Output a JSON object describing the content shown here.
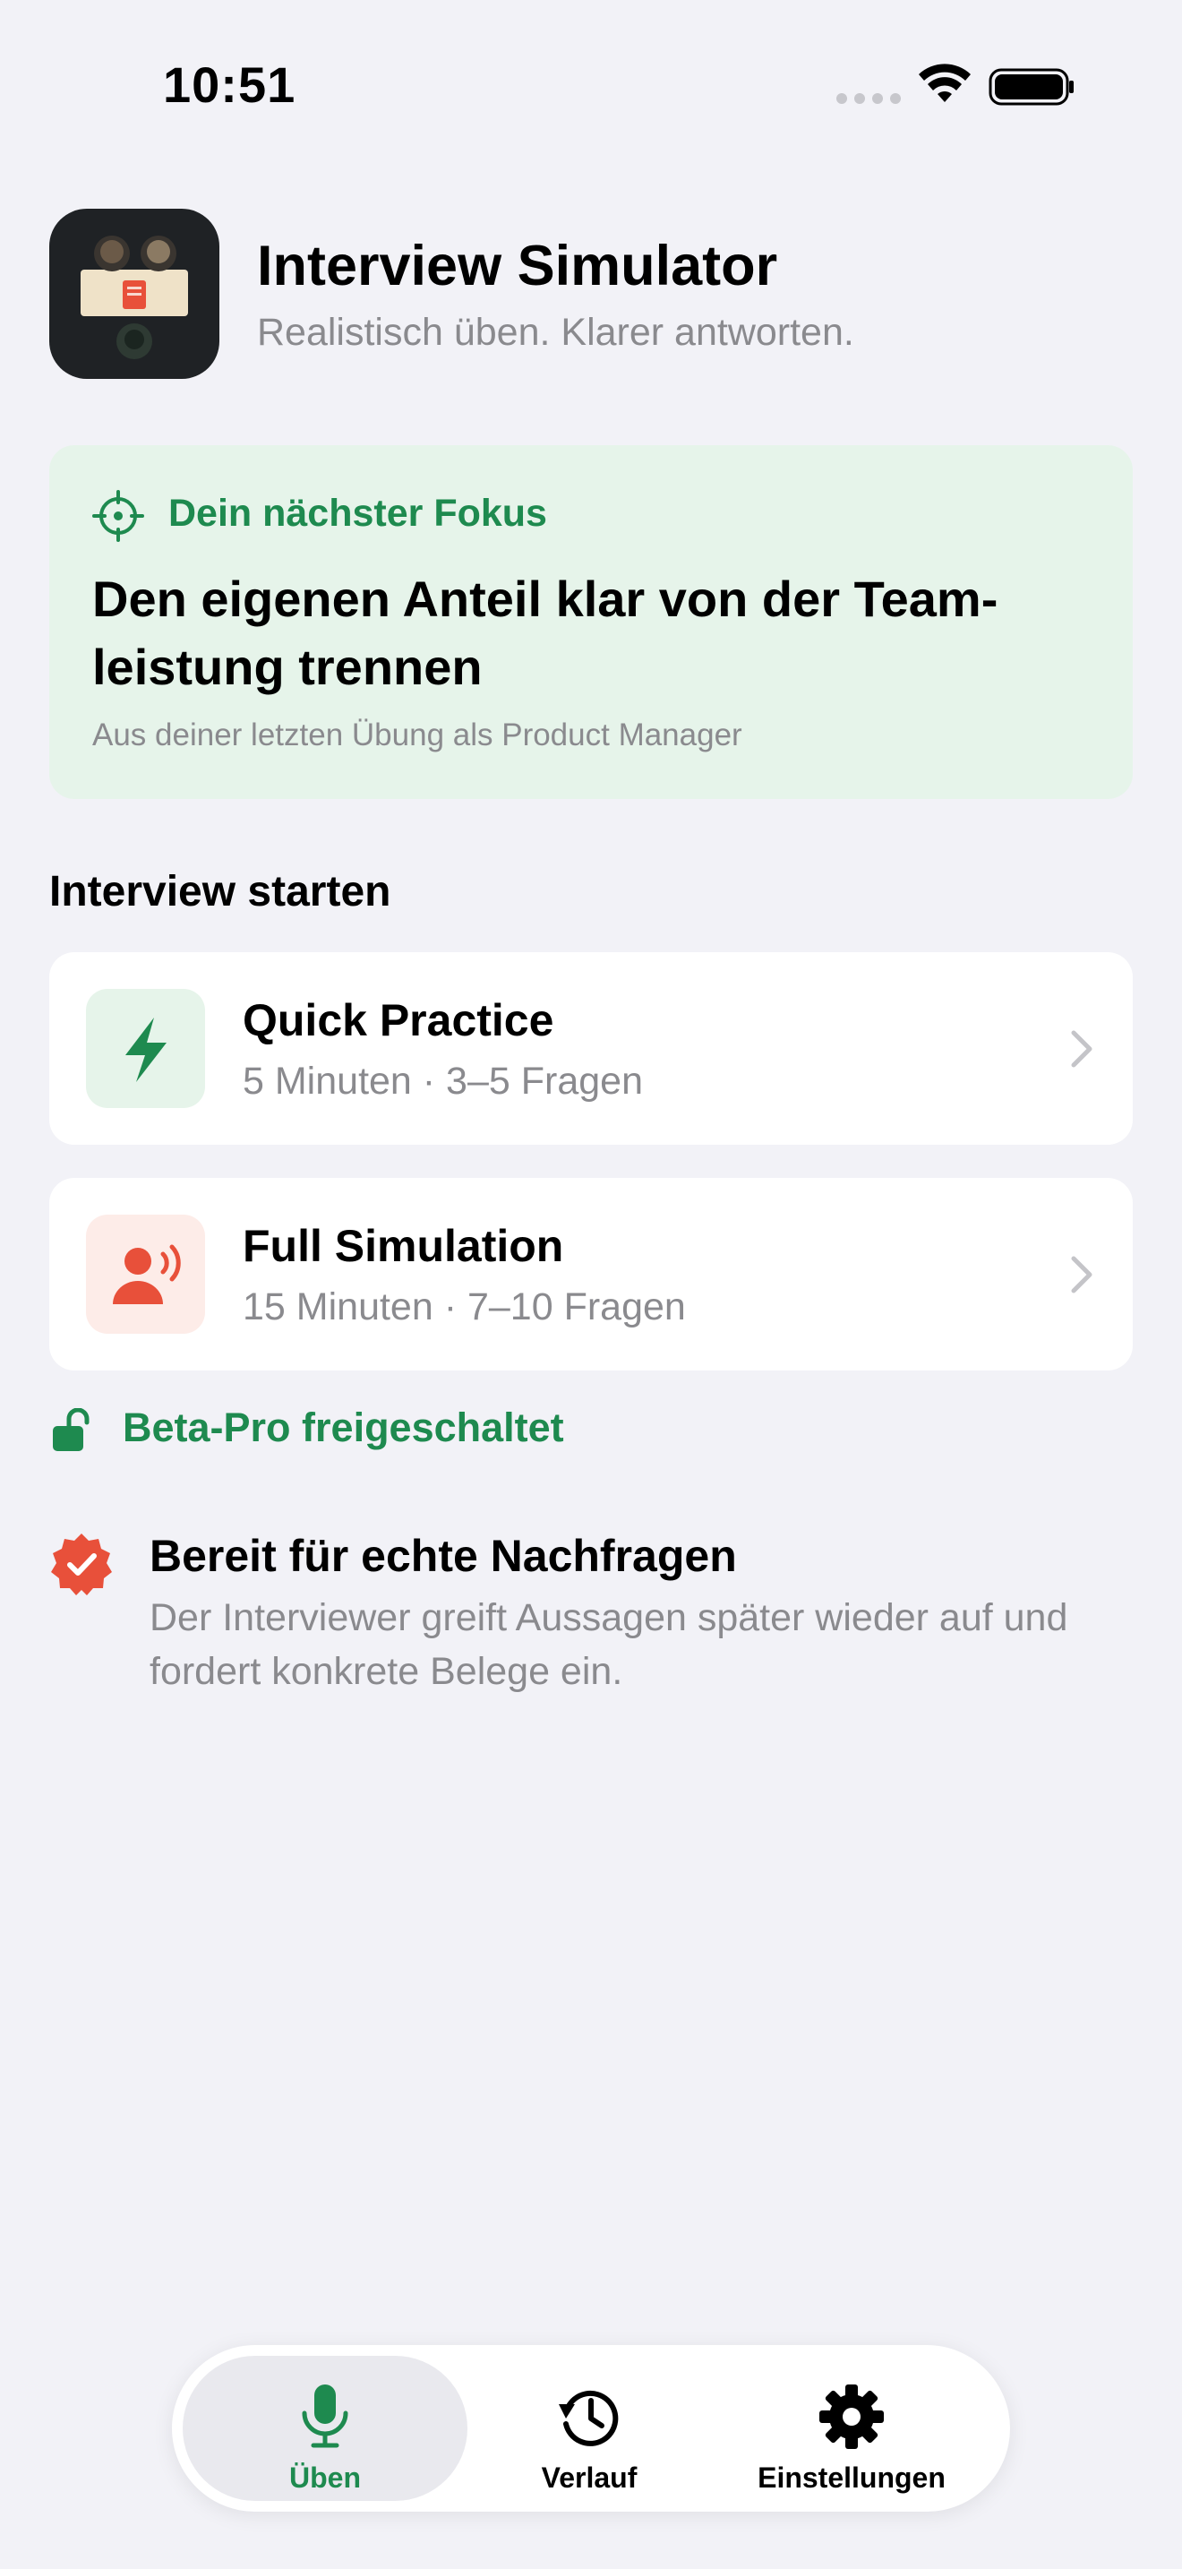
{
  "status_bar": {
    "time": "10:51",
    "icons": [
      "signal-dots-icon",
      "wifi-icon",
      "battery-icon"
    ]
  },
  "header": {
    "title": "Interview Simulator",
    "subtitle": "Realistisch üben. Klarer antworten.",
    "icon": "app-icon-interview"
  },
  "focus": {
    "label": "Dein nächster Fokus",
    "headline": "Den eigenen Anteil klar von der Team-leistung trennen",
    "note": "Aus deiner letzten Übung als Product Manager",
    "icon": "crosshair-icon",
    "accent": "#1E8A4F",
    "background": "#E6F4EA"
  },
  "section": {
    "title": "Interview starten"
  },
  "modes": [
    {
      "title": "Quick Practice",
      "meta": "5 Minuten · 3–5 Fragen",
      "icon": "bolt-icon",
      "color": "#1E8A4F"
    },
    {
      "title": "Full Simulation",
      "meta": "15 Minuten · 7–10 Fragen",
      "icon": "speaking-person-icon",
      "color": "#E8503A"
    }
  ],
  "beta": {
    "label": "Beta-Pro freigeschaltet",
    "icon": "unlock-icon"
  },
  "ready": {
    "title": "Bereit für echte Nachfragen",
    "text": "Der Interviewer greift Aussagen später wieder auf und fordert konkrete Belege ein.",
    "icon": "verified-badge-icon",
    "color": "#E8503A"
  },
  "tabs": [
    {
      "label": "Üben",
      "icon": "microphone-icon",
      "active": true
    },
    {
      "label": "Verlauf",
      "icon": "history-icon",
      "active": false
    },
    {
      "label": "Einstellungen",
      "icon": "gear-icon",
      "active": false
    }
  ]
}
